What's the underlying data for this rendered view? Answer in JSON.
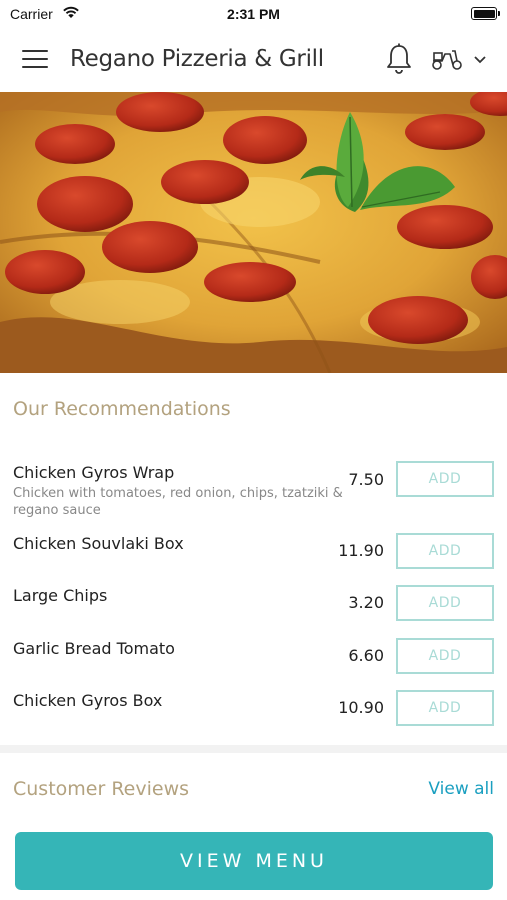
{
  "status_bar": {
    "carrier": "Carrier",
    "time": "2:31 PM"
  },
  "header": {
    "title": "Regano Pizzeria & Grill",
    "icons": [
      "menu-icon",
      "bell-icon",
      "scooter-icon",
      "chevron-down-icon"
    ]
  },
  "recommendations": {
    "title": "Our Recommendations",
    "items": [
      {
        "name": "Chicken Gyros Wrap",
        "description": "Chicken with tomatoes, red onion, chips, tzatziki & regano sauce",
        "price": "7.50",
        "button": "ADD"
      },
      {
        "name": "Chicken Souvlaki Box",
        "description": "",
        "price": "11.90",
        "button": "ADD"
      },
      {
        "name": "Large Chips",
        "description": "",
        "price": "3.20",
        "button": "ADD"
      },
      {
        "name": "Garlic Bread Tomato",
        "description": "",
        "price": "6.60",
        "button": "ADD"
      },
      {
        "name": "Chicken Gyros Box",
        "description": "",
        "price": "10.90",
        "button": "ADD"
      }
    ]
  },
  "reviews": {
    "title": "Customer Reviews",
    "view_all": "View all"
  },
  "footer": {
    "view_menu": "VIEW MENU"
  },
  "colors": {
    "accent": "#35b5b7",
    "section_title": "#b3a27f",
    "add_border": "#a9dbd6",
    "link": "#1a9fc0"
  }
}
